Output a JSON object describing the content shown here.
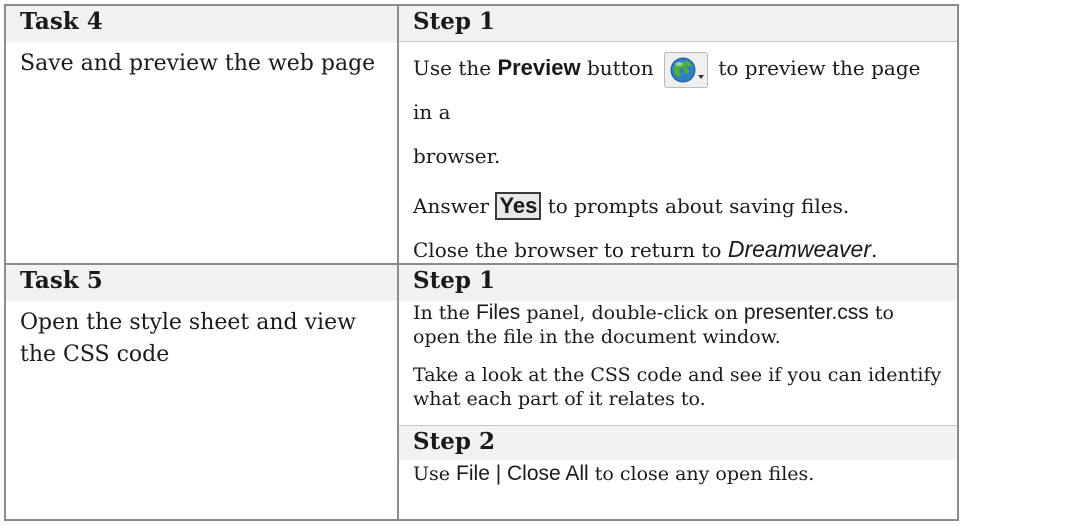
{
  "rows": [
    {
      "task_title": "Task 4",
      "task_desc": "Save and preview the web page",
      "steps": [
        {
          "title": "Step 1",
          "p1": {
            "a": "Use the ",
            "ui": "Preview",
            "b": " button",
            "c": " to preview the page in a",
            "d": "browser."
          },
          "p2": {
            "a": "Answer ",
            "ui": "Yes",
            "b": " to prompts about saving files."
          },
          "p3": {
            "a": "Close the browser to return to ",
            "em": "Dreamweaver",
            "b": "."
          }
        }
      ]
    },
    {
      "task_title": "Task 5",
      "task_desc": "Open the style sheet and view the CSS code",
      "steps": [
        {
          "title": "Step 1",
          "p1": {
            "a": "In the ",
            "ui1": "Files",
            "b": " panel, double-click on ",
            "ui2": "presenter.css",
            "c": " to",
            "d": "open the file in the document window."
          },
          "p2": {
            "a": "Take a look at the CSS code and see if you can identify",
            "b": "what each part of it relates to."
          }
        },
        {
          "title": "Step 2",
          "p1": {
            "a": "Use ",
            "ui": "File | Close All",
            "b": " to close any open files."
          }
        }
      ]
    }
  ],
  "icons": {
    "preview": "globe-preview-icon"
  },
  "colors": {
    "border": "#8c8c8c",
    "header_bg": "#f2f2f2",
    "globe_blue": "#2f7fc4",
    "globe_green": "#4caf3a"
  }
}
